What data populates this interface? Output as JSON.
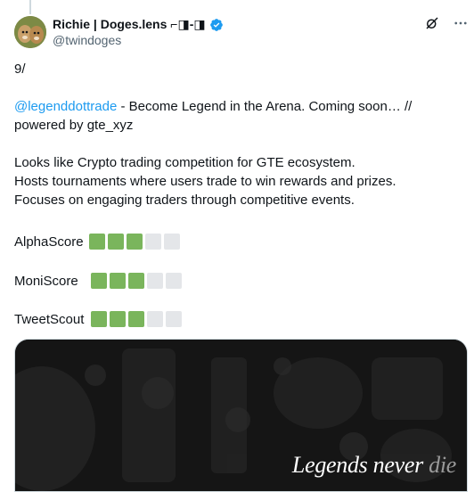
{
  "author": {
    "display_name": "Richie | Doges.lens ⌐◨-◨",
    "handle": "@twindoges",
    "verified": true
  },
  "post": {
    "line_number": "9/",
    "mention": "@legenddottrade",
    "mention_line_rest": " - Become Legend in the Arena. Coming soon… //",
    "powered_line": "powered by gte_xyz",
    "desc_line_1": "Looks like Crypto trading competition for GTE ecosystem.",
    "desc_line_2": "Hosts tournaments where users trade to win rewards and prizes.",
    "desc_line_3": "Focuses on engaging traders through competitive events."
  },
  "scores": [
    {
      "label": "AlphaScore",
      "filled": 3,
      "total": 5
    },
    {
      "label": "MoniScore",
      "filled": 3,
      "total": 5
    },
    {
      "label": "TweetScout",
      "filled": 3,
      "total": 5
    }
  ],
  "media": {
    "tagline_main": "Legends never ",
    "tagline_dim": "die"
  },
  "colors": {
    "accent": "#1d9bf0",
    "score_on": "#7ab55c",
    "score_off": "#e4e6e9",
    "media_bg": "#141414"
  },
  "icons": [
    "verified-badge-icon",
    "grok-icon",
    "more-options-icon"
  ]
}
